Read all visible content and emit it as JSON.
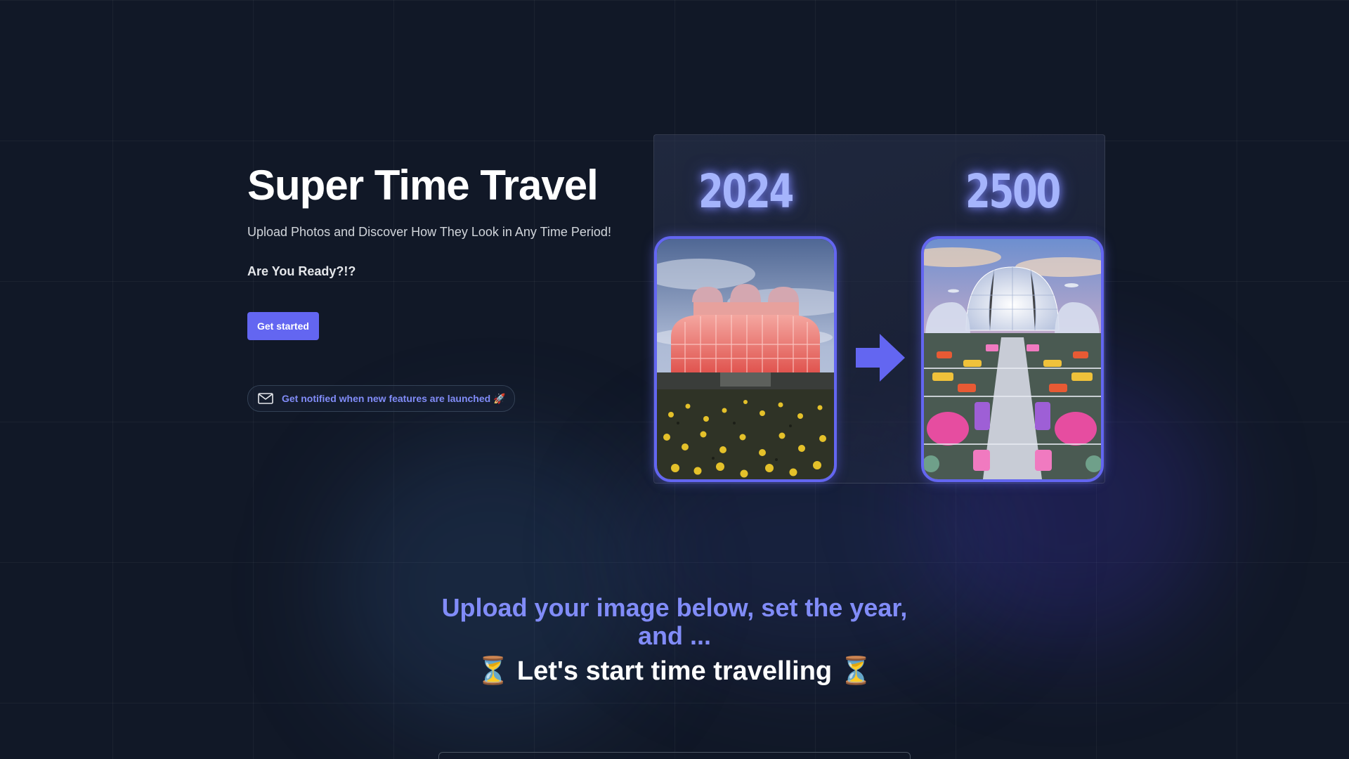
{
  "hero": {
    "title": "Super Time Travel",
    "subtitle": "Upload Photos and Discover How They Look in Any Time Period!",
    "ready_text": "Are You Ready?!?",
    "cta_label": "Get started",
    "notify_text": "Get notified when new features are launched 🚀"
  },
  "comparison": {
    "before_year": "2024",
    "after_year": "2500"
  },
  "bottom": {
    "heading_line1": "Upload your image below, set the year,",
    "heading_line2": "and ...",
    "cta_text": "⏳ Let's start time travelling ⏳"
  },
  "colors": {
    "background": "#111827",
    "accent": "#6366f1",
    "accent_light": "#818cf8",
    "year_glow": "#a5b4fc"
  },
  "icons": {
    "notify": "mail-icon",
    "compare": "arrow-right-icon"
  }
}
